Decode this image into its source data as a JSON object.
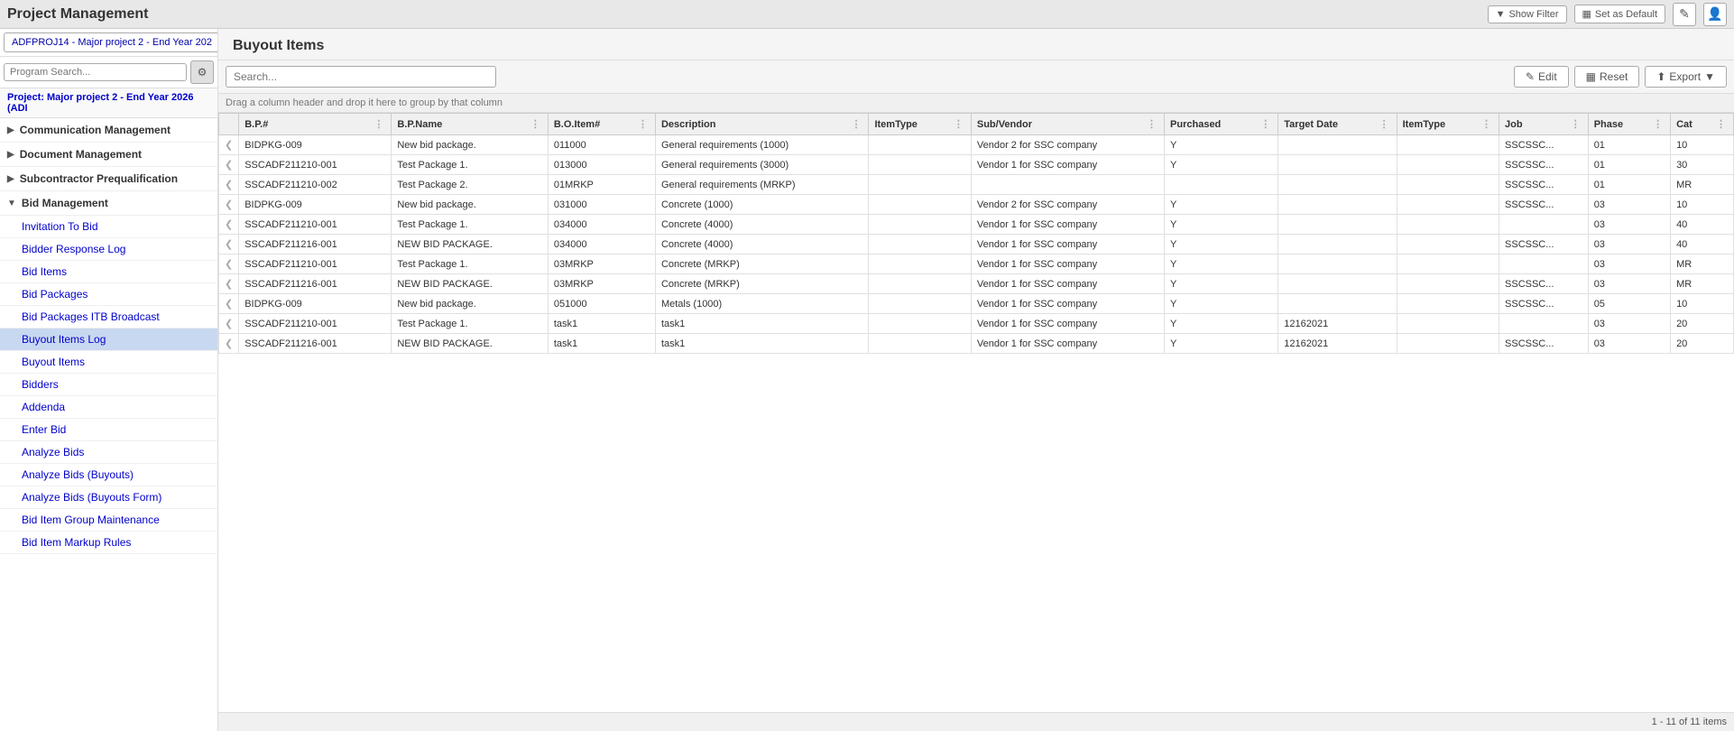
{
  "app": {
    "title": "Project Management"
  },
  "topbar": {
    "show_filter_label": "Show Filter",
    "set_as_default_label": "Set as Default"
  },
  "sidebar": {
    "project_select_value": "ADFPROJ14 - Major project 2 - End Year 202",
    "search_placeholder": "Program Search...",
    "project_label": "Project: Major project 2 - End Year 2026 (ADI",
    "sections": [
      {
        "id": "communication",
        "label": "Communication Management",
        "expanded": false
      },
      {
        "id": "document",
        "label": "Document Management",
        "expanded": false
      },
      {
        "id": "subcontractor",
        "label": "Subcontractor Prequalification",
        "expanded": false
      },
      {
        "id": "bid-management",
        "label": "Bid Management",
        "expanded": true
      }
    ],
    "bid_management_items": [
      {
        "id": "invitation-to-bid",
        "label": "Invitation To Bid",
        "active": false
      },
      {
        "id": "bidder-response-log",
        "label": "Bidder Response Log",
        "active": false
      },
      {
        "id": "bid-items",
        "label": "Bid Items",
        "active": false
      },
      {
        "id": "bid-packages",
        "label": "Bid Packages",
        "active": false
      },
      {
        "id": "bid-packages-itb-broadcast",
        "label": "Bid Packages ITB Broadcast",
        "active": false
      },
      {
        "id": "buyout-items-log",
        "label": "Buyout Items Log",
        "active": true
      },
      {
        "id": "buyout-items",
        "label": "Buyout Items",
        "active": false
      },
      {
        "id": "bidders",
        "label": "Bidders",
        "active": false
      },
      {
        "id": "addenda",
        "label": "Addenda",
        "active": false
      },
      {
        "id": "enter-bid",
        "label": "Enter Bid",
        "active": false
      },
      {
        "id": "analyze-bids",
        "label": "Analyze Bids",
        "active": false
      },
      {
        "id": "analyze-bids-buyouts",
        "label": "Analyze Bids (Buyouts)",
        "active": false
      },
      {
        "id": "analyze-bids-buyouts-form",
        "label": "Analyze Bids (Buyouts Form)",
        "active": false
      },
      {
        "id": "bid-item-group-maintenance",
        "label": "Bid Item Group Maintenance",
        "active": false
      },
      {
        "id": "bid-item-markup-rules",
        "label": "Bid Item Markup Rules",
        "active": false
      }
    ]
  },
  "page": {
    "title": "Buyout Items",
    "search_placeholder": "Search...",
    "drag_hint": "Drag a column header and drop it here to group by that column",
    "edit_label": "Edit",
    "reset_label": "Reset",
    "export_label": "Export",
    "footer": "1 - 11 of 11 items"
  },
  "table": {
    "columns": [
      {
        "id": "nav",
        "label": ""
      },
      {
        "id": "bp_num",
        "label": "B.P.#"
      },
      {
        "id": "bp_name",
        "label": "B.P.Name"
      },
      {
        "id": "bo_item",
        "label": "B.O.Item#"
      },
      {
        "id": "description",
        "label": "Description"
      },
      {
        "id": "item_type",
        "label": "ItemType"
      },
      {
        "id": "sub_vendor",
        "label": "Sub/Vendor"
      },
      {
        "id": "purchased",
        "label": "Purchased"
      },
      {
        "id": "target_date",
        "label": "Target Date"
      },
      {
        "id": "item_type2",
        "label": "ItemType"
      },
      {
        "id": "job",
        "label": "Job"
      },
      {
        "id": "phase",
        "label": "Phase"
      },
      {
        "id": "cat",
        "label": "Cat"
      }
    ],
    "rows": [
      {
        "bp_num": "BIDPKG-009",
        "bp_name": "New bid package.",
        "bo_item": "011000",
        "description": "General requirements (1000)",
        "item_type": "",
        "sub_vendor": "Vendor 2 for SSC company",
        "purchased": "Y",
        "target_date": "",
        "item_type2": "",
        "job": "SSCSSC...",
        "phase": "01",
        "cat": "10"
      },
      {
        "bp_num": "SSCADF211210-001",
        "bp_name": "Test Package 1.",
        "bo_item": "013000",
        "description": "General requirements (3000)",
        "item_type": "",
        "sub_vendor": "Vendor 1 for SSC company",
        "purchased": "Y",
        "target_date": "",
        "item_type2": "",
        "job": "SSCSSC...",
        "phase": "01",
        "cat": "30"
      },
      {
        "bp_num": "SSCADF211210-002",
        "bp_name": "Test Package 2.",
        "bo_item": "01MRKP",
        "description": "General requirements (MRKP)",
        "item_type": "",
        "sub_vendor": "",
        "purchased": "",
        "target_date": "",
        "item_type2": "",
        "job": "SSCSSC...",
        "phase": "01",
        "cat": "MR"
      },
      {
        "bp_num": "BIDPKG-009",
        "bp_name": "New bid package.",
        "bo_item": "031000",
        "description": "Concrete (1000)",
        "item_type": "",
        "sub_vendor": "Vendor 2 for SSC company",
        "purchased": "Y",
        "target_date": "",
        "item_type2": "",
        "job": "SSCSSC...",
        "phase": "03",
        "cat": "10"
      },
      {
        "bp_num": "SSCADF211210-001",
        "bp_name": "Test Package 1.",
        "bo_item": "034000",
        "description": "Concrete (4000)",
        "item_type": "",
        "sub_vendor": "Vendor 1 for SSC company",
        "purchased": "Y",
        "target_date": "",
        "item_type2": "",
        "job": "",
        "phase": "03",
        "cat": "40"
      },
      {
        "bp_num": "SSCADF211216-001",
        "bp_name": "NEW BID PACKAGE.",
        "bo_item": "034000",
        "description": "Concrete (4000)",
        "item_type": "",
        "sub_vendor": "Vendor 1 for SSC company",
        "purchased": "Y",
        "target_date": "",
        "item_type2": "",
        "job": "SSCSSC...",
        "phase": "03",
        "cat": "40"
      },
      {
        "bp_num": "SSCADF211210-001",
        "bp_name": "Test Package 1.",
        "bo_item": "03MRKP",
        "description": "Concrete (MRKP)",
        "item_type": "",
        "sub_vendor": "Vendor 1 for SSC company",
        "purchased": "Y",
        "target_date": "",
        "item_type2": "",
        "job": "",
        "phase": "03",
        "cat": "MR"
      },
      {
        "bp_num": "SSCADF211216-001",
        "bp_name": "NEW BID PACKAGE.",
        "bo_item": "03MRKP",
        "description": "Concrete (MRKP)",
        "item_type": "",
        "sub_vendor": "Vendor 1 for SSC company",
        "purchased": "Y",
        "target_date": "",
        "item_type2": "",
        "job": "SSCSSC...",
        "phase": "03",
        "cat": "MR"
      },
      {
        "bp_num": "BIDPKG-009",
        "bp_name": "New bid package.",
        "bo_item": "051000",
        "description": "Metals (1000)",
        "item_type": "",
        "sub_vendor": "Vendor 1 for SSC company",
        "purchased": "Y",
        "target_date": "",
        "item_type2": "",
        "job": "SSCSSC...",
        "phase": "05",
        "cat": "10"
      },
      {
        "bp_num": "SSCADF211210-001",
        "bp_name": "Test Package 1.",
        "bo_item": "task1",
        "description": "task1",
        "item_type": "",
        "sub_vendor": "Vendor 1 for SSC company",
        "purchased": "Y",
        "target_date": "12162021",
        "item_type2": "",
        "job": "",
        "phase": "03",
        "cat": "20"
      },
      {
        "bp_num": "SSCADF211216-001",
        "bp_name": "NEW BID PACKAGE.",
        "bo_item": "task1",
        "description": "task1",
        "item_type": "",
        "sub_vendor": "Vendor 1 for SSC company",
        "purchased": "Y",
        "target_date": "12162021",
        "item_type2": "",
        "job": "SSCSSC...",
        "phase": "03",
        "cat": "20"
      }
    ]
  }
}
